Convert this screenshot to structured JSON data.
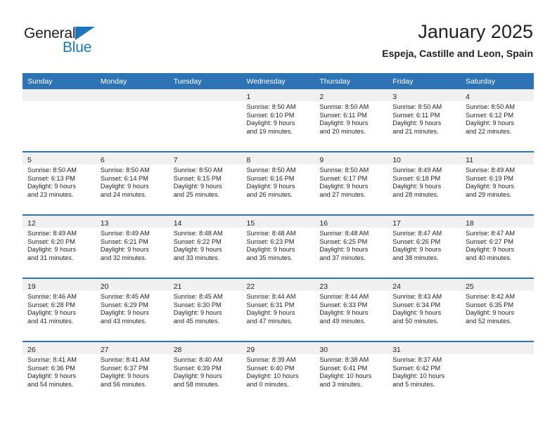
{
  "brand": {
    "name_top": "General",
    "name_bottom": "Blue",
    "accent_color": "#1c76bc"
  },
  "header": {
    "title": "January 2025",
    "subtitle": "Espeja, Castille and Leon, Spain"
  },
  "calendar": {
    "header_color": "#2e74b5",
    "band_color": "#f0f0f0",
    "weekday_headers": [
      "Sunday",
      "Monday",
      "Tuesday",
      "Wednesday",
      "Thursday",
      "Friday",
      "Saturday"
    ],
    "weeks": [
      [
        {
          "day": "",
          "sunrise": "",
          "sunset": "",
          "daylight_line1": "",
          "daylight_line2": ""
        },
        {
          "day": "",
          "sunrise": "",
          "sunset": "",
          "daylight_line1": "",
          "daylight_line2": ""
        },
        {
          "day": "",
          "sunrise": "",
          "sunset": "",
          "daylight_line1": "",
          "daylight_line2": ""
        },
        {
          "day": "1",
          "sunrise": "Sunrise: 8:50 AM",
          "sunset": "Sunset: 6:10 PM",
          "daylight_line1": "Daylight: 9 hours",
          "daylight_line2": "and 19 minutes."
        },
        {
          "day": "2",
          "sunrise": "Sunrise: 8:50 AM",
          "sunset": "Sunset: 6:11 PM",
          "daylight_line1": "Daylight: 9 hours",
          "daylight_line2": "and 20 minutes."
        },
        {
          "day": "3",
          "sunrise": "Sunrise: 8:50 AM",
          "sunset": "Sunset: 6:11 PM",
          "daylight_line1": "Daylight: 9 hours",
          "daylight_line2": "and 21 minutes."
        },
        {
          "day": "4",
          "sunrise": "Sunrise: 8:50 AM",
          "sunset": "Sunset: 6:12 PM",
          "daylight_line1": "Daylight: 9 hours",
          "daylight_line2": "and 22 minutes."
        }
      ],
      [
        {
          "day": "5",
          "sunrise": "Sunrise: 8:50 AM",
          "sunset": "Sunset: 6:13 PM",
          "daylight_line1": "Daylight: 9 hours",
          "daylight_line2": "and 23 minutes."
        },
        {
          "day": "6",
          "sunrise": "Sunrise: 8:50 AM",
          "sunset": "Sunset: 6:14 PM",
          "daylight_line1": "Daylight: 9 hours",
          "daylight_line2": "and 24 minutes."
        },
        {
          "day": "7",
          "sunrise": "Sunrise: 8:50 AM",
          "sunset": "Sunset: 6:15 PM",
          "daylight_line1": "Daylight: 9 hours",
          "daylight_line2": "and 25 minutes."
        },
        {
          "day": "8",
          "sunrise": "Sunrise: 8:50 AM",
          "sunset": "Sunset: 6:16 PM",
          "daylight_line1": "Daylight: 9 hours",
          "daylight_line2": "and 26 minutes."
        },
        {
          "day": "9",
          "sunrise": "Sunrise: 8:50 AM",
          "sunset": "Sunset: 6:17 PM",
          "daylight_line1": "Daylight: 9 hours",
          "daylight_line2": "and 27 minutes."
        },
        {
          "day": "10",
          "sunrise": "Sunrise: 8:49 AM",
          "sunset": "Sunset: 6:18 PM",
          "daylight_line1": "Daylight: 9 hours",
          "daylight_line2": "and 28 minutes."
        },
        {
          "day": "11",
          "sunrise": "Sunrise: 8:49 AM",
          "sunset": "Sunset: 6:19 PM",
          "daylight_line1": "Daylight: 9 hours",
          "daylight_line2": "and 29 minutes."
        }
      ],
      [
        {
          "day": "12",
          "sunrise": "Sunrise: 8:49 AM",
          "sunset": "Sunset: 6:20 PM",
          "daylight_line1": "Daylight: 9 hours",
          "daylight_line2": "and 31 minutes."
        },
        {
          "day": "13",
          "sunrise": "Sunrise: 8:49 AM",
          "sunset": "Sunset: 6:21 PM",
          "daylight_line1": "Daylight: 9 hours",
          "daylight_line2": "and 32 minutes."
        },
        {
          "day": "14",
          "sunrise": "Sunrise: 8:48 AM",
          "sunset": "Sunset: 6:22 PM",
          "daylight_line1": "Daylight: 9 hours",
          "daylight_line2": "and 33 minutes."
        },
        {
          "day": "15",
          "sunrise": "Sunrise: 8:48 AM",
          "sunset": "Sunset: 6:23 PM",
          "daylight_line1": "Daylight: 9 hours",
          "daylight_line2": "and 35 minutes."
        },
        {
          "day": "16",
          "sunrise": "Sunrise: 8:48 AM",
          "sunset": "Sunset: 6:25 PM",
          "daylight_line1": "Daylight: 9 hours",
          "daylight_line2": "and 37 minutes."
        },
        {
          "day": "17",
          "sunrise": "Sunrise: 8:47 AM",
          "sunset": "Sunset: 6:26 PM",
          "daylight_line1": "Daylight: 9 hours",
          "daylight_line2": "and 38 minutes."
        },
        {
          "day": "18",
          "sunrise": "Sunrise: 8:47 AM",
          "sunset": "Sunset: 6:27 PM",
          "daylight_line1": "Daylight: 9 hours",
          "daylight_line2": "and 40 minutes."
        }
      ],
      [
        {
          "day": "19",
          "sunrise": "Sunrise: 8:46 AM",
          "sunset": "Sunset: 6:28 PM",
          "daylight_line1": "Daylight: 9 hours",
          "daylight_line2": "and 41 minutes."
        },
        {
          "day": "20",
          "sunrise": "Sunrise: 8:45 AM",
          "sunset": "Sunset: 6:29 PM",
          "daylight_line1": "Daylight: 9 hours",
          "daylight_line2": "and 43 minutes."
        },
        {
          "day": "21",
          "sunrise": "Sunrise: 8:45 AM",
          "sunset": "Sunset: 6:30 PM",
          "daylight_line1": "Daylight: 9 hours",
          "daylight_line2": "and 45 minutes."
        },
        {
          "day": "22",
          "sunrise": "Sunrise: 8:44 AM",
          "sunset": "Sunset: 6:31 PM",
          "daylight_line1": "Daylight: 9 hours",
          "daylight_line2": "and 47 minutes."
        },
        {
          "day": "23",
          "sunrise": "Sunrise: 8:44 AM",
          "sunset": "Sunset: 6:33 PM",
          "daylight_line1": "Daylight: 9 hours",
          "daylight_line2": "and 49 minutes."
        },
        {
          "day": "24",
          "sunrise": "Sunrise: 8:43 AM",
          "sunset": "Sunset: 6:34 PM",
          "daylight_line1": "Daylight: 9 hours",
          "daylight_line2": "and 50 minutes."
        },
        {
          "day": "25",
          "sunrise": "Sunrise: 8:42 AM",
          "sunset": "Sunset: 6:35 PM",
          "daylight_line1": "Daylight: 9 hours",
          "daylight_line2": "and 52 minutes."
        }
      ],
      [
        {
          "day": "26",
          "sunrise": "Sunrise: 8:41 AM",
          "sunset": "Sunset: 6:36 PM",
          "daylight_line1": "Daylight: 9 hours",
          "daylight_line2": "and 54 minutes."
        },
        {
          "day": "27",
          "sunrise": "Sunrise: 8:41 AM",
          "sunset": "Sunset: 6:37 PM",
          "daylight_line1": "Daylight: 9 hours",
          "daylight_line2": "and 56 minutes."
        },
        {
          "day": "28",
          "sunrise": "Sunrise: 8:40 AM",
          "sunset": "Sunset: 6:39 PM",
          "daylight_line1": "Daylight: 9 hours",
          "daylight_line2": "and 58 minutes."
        },
        {
          "day": "29",
          "sunrise": "Sunrise: 8:39 AM",
          "sunset": "Sunset: 6:40 PM",
          "daylight_line1": "Daylight: 10 hours",
          "daylight_line2": "and 0 minutes."
        },
        {
          "day": "30",
          "sunrise": "Sunrise: 8:38 AM",
          "sunset": "Sunset: 6:41 PM",
          "daylight_line1": "Daylight: 10 hours",
          "daylight_line2": "and 3 minutes."
        },
        {
          "day": "31",
          "sunrise": "Sunrise: 8:37 AM",
          "sunset": "Sunset: 6:42 PM",
          "daylight_line1": "Daylight: 10 hours",
          "daylight_line2": "and 5 minutes."
        },
        {
          "day": "",
          "sunrise": "",
          "sunset": "",
          "daylight_line1": "",
          "daylight_line2": ""
        }
      ]
    ]
  }
}
